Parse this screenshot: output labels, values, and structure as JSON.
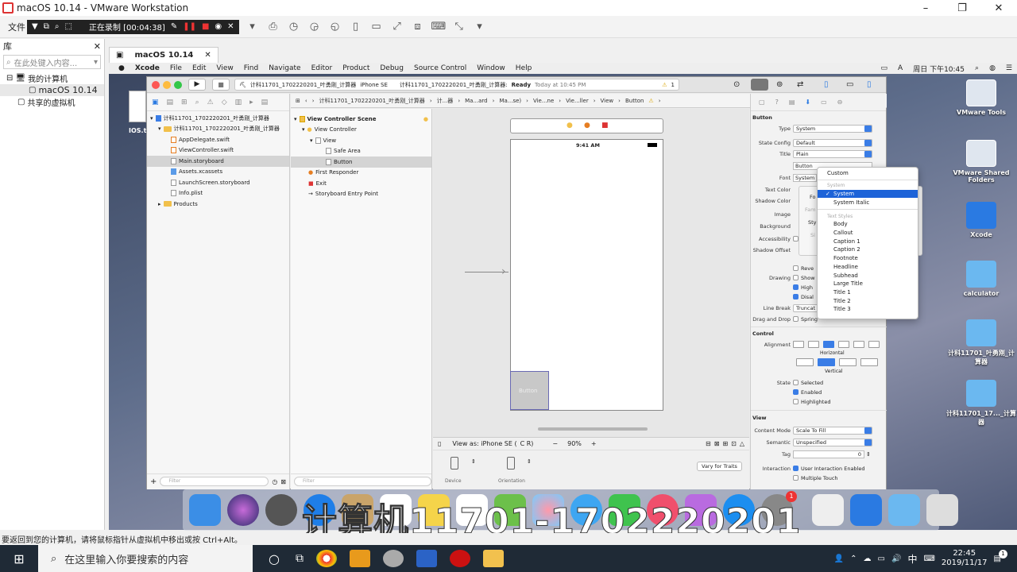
{
  "vm": {
    "title": "macOS 10.14 - VMware Workstation",
    "menu_file": "文件",
    "rec_status": "正在录制 [00:04:38]",
    "tab_label": "macOS 10.14",
    "status_hint": "要返回到您的计算机，请将鼠标指针从虚拟机中移出或按 Ctrl+Alt。"
  },
  "library": {
    "title": "库",
    "search_placeholder": "在此处键入内容...",
    "my_computer": "我的计算机",
    "vm_item": "macOS 10.14",
    "shared": "共享的虚拟机"
  },
  "mac_menu": {
    "app": "Xcode",
    "items": [
      "File",
      "Edit",
      "View",
      "Find",
      "Navigate",
      "Editor",
      "Product",
      "Debug",
      "Source Control",
      "Window",
      "Help"
    ],
    "clock": "周日 下午10:45"
  },
  "xcode": {
    "scheme": "计科11701_1702220201_叶勇刚_计算器",
    "device": "iPhone SE",
    "status_project": "计科11701_1702220201_叶勇刚_计算器:",
    "status_ready": "Ready",
    "status_time": "Today at 10:45 PM",
    "warning_count": "1",
    "project_root": "计科11701_1702220201_叶勇刚_计算器",
    "group": "计科11701_1702220201_叶勇刚_计算器",
    "files": [
      "AppDelegate.swift",
      "ViewController.swift",
      "Main.storyboard",
      "Assets.xcassets",
      "LaunchScreen.storyboard",
      "Info.plist"
    ],
    "products": "Products",
    "filter_placeholder": "Filter",
    "jump": [
      "计科11701_1702220201_叶勇刚_计算器",
      "计...器",
      "Ma...ard",
      "Ma...se)",
      "Vie...ne",
      "Vie...ller",
      "View",
      "Button"
    ],
    "outline": {
      "scene": "View Controller Scene",
      "vc": "View Controller",
      "view": "View",
      "safe_area": "Safe Area",
      "button": "Button",
      "first_responder": "First Responder",
      "exit": "Exit",
      "entry": "Storyboard Entry Point"
    },
    "canvas": {
      "time": "9:41 AM",
      "button_label": "Button",
      "view_as": "View as: iPhone SE (",
      "view_as_tail": "C  R)",
      "zoom": "90%",
      "device": "Device",
      "orientation": "Orientation",
      "vary": "Vary for Traits"
    },
    "inspector": {
      "section_button": "Button",
      "type_label": "Type",
      "type_value": "System",
      "state_label": "State Config",
      "state_value": "Default",
      "title_label": "Title",
      "title_value": "Plain",
      "title_text": "Button",
      "font_label": "Font",
      "font_value": "System",
      "text_color": "Text Color",
      "shadow_color": "Shadow Color",
      "image": "Image",
      "background": "Background",
      "accessibility": "Accessibility",
      "shadow_offset": "Shadow Offset",
      "reverses": "Reve",
      "drawing": "Drawing",
      "shows": "Show",
      "highlighted": "High",
      "disabled": "Disal",
      "line_break_label": "Line Break",
      "line_break_value": "Truncat",
      "drag_label": "Drag and Drop",
      "drag_value": "Spring",
      "section_control": "Control",
      "alignment": "Alignment",
      "horizontal": "Horizontal",
      "vertical": "Vertical",
      "state": "State",
      "selected": "Selected",
      "enabled": "Enabled",
      "highlighted_full": "Highlighted",
      "section_view": "View",
      "content_mode_label": "Content Mode",
      "content_mode_value": "Scale To Fill",
      "semantic_label": "Semantic",
      "semantic_value": "Unspecified",
      "tag_label": "Tag",
      "tag_value": "0",
      "interaction": "Interaction",
      "user_interaction": "User Interaction Enabled",
      "multiple_touch": "Multiple Touch",
      "font_popup_fo": "Fo",
      "font_popup_fam": "Fam",
      "font_popup_sty": "Sty",
      "font_popup_si": "Si"
    },
    "font_menu": {
      "custom": "Custom",
      "system_head": "System",
      "system": "System",
      "system_italic": "System Italic",
      "text_styles_head": "Text Styles",
      "styles": [
        "Body",
        "Callout",
        "Caption 1",
        "Caption 2",
        "Footnote",
        "Headline",
        "Subhead",
        "Large Title",
        "Title 1",
        "Title 2",
        "Title 3"
      ]
    }
  },
  "desktop": {
    "txt_file": "IOS.t",
    "icons": [
      "VMware Tools",
      "VMware Shared Folders",
      "Xcode",
      "calculator",
      "计科11701_叶勇刚_计算器",
      "计科11701_17..._计算器"
    ]
  },
  "watermark": "计算机11701-1702220201",
  "taskbar": {
    "search": "在这里输入你要搜索的内容",
    "time": "22:45",
    "date": "2019/11/17",
    "ime": "中",
    "badge": "1",
    "dock_badge": "1"
  }
}
